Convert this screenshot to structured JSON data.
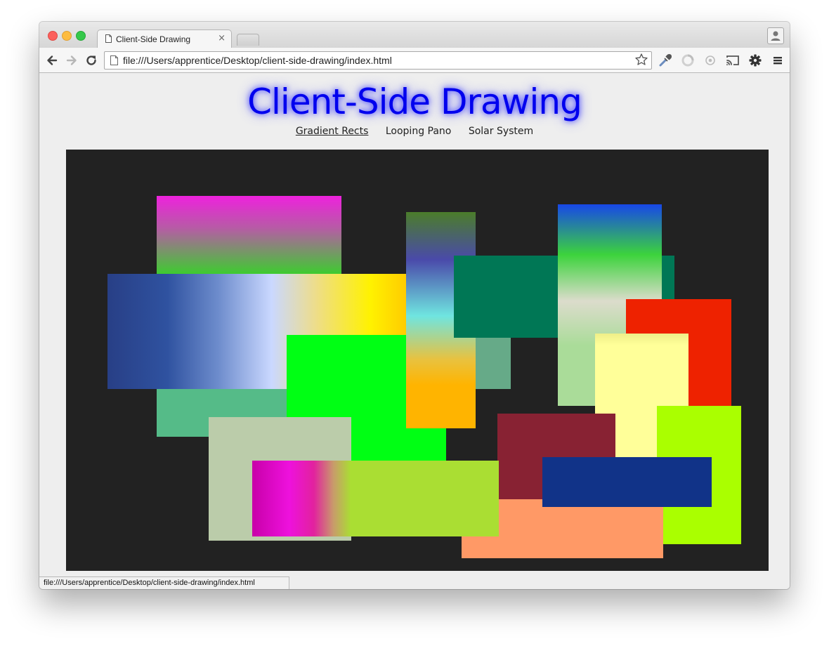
{
  "browser": {
    "tab_title": "Client-Side Drawing",
    "tab_close": "×",
    "url": "file:///Users/apprentice/Desktop/client-side-drawing/index.html",
    "status_url": "file:///Users/apprentice/Desktop/client-side-drawing/index.html"
  },
  "page": {
    "title": "Client-Side Drawing",
    "nav": [
      {
        "label": "Gradient Rects",
        "active": true
      },
      {
        "label": "Looping Pano",
        "active": false
      },
      {
        "label": "Solar System",
        "active": false
      }
    ]
  },
  "colors": {
    "title_color": "#0000ee",
    "canvas_background": "#222222",
    "traffic_red": "#fc605c",
    "traffic_yellow": "#fdbc40",
    "traffic_green": "#34c84a"
  }
}
